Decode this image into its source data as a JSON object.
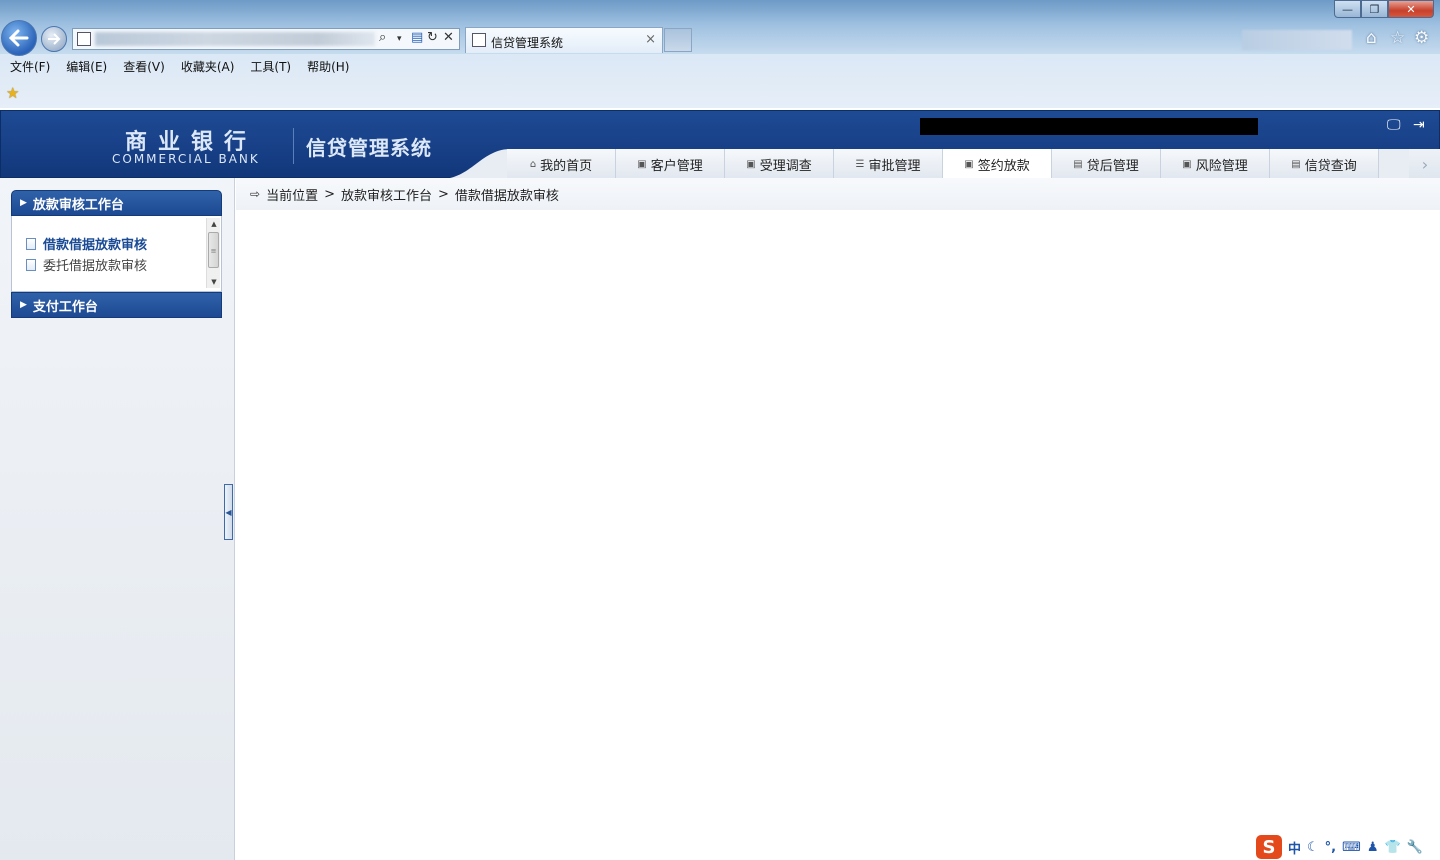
{
  "browser": {
    "tab_title": "信贷管理系统",
    "menu": [
      "文件(F)",
      "编辑(E)",
      "查看(V)",
      "收藏夹(A)",
      "工具(T)",
      "帮助(H)"
    ],
    "tab_close": "×",
    "win_min": "—",
    "win_max": "❐",
    "win_close": "✕"
  },
  "header": {
    "bank_cn": "商业银行",
    "bank_en": "COMMERCIAL BANK",
    "system_name": "信贷管理系统"
  },
  "nav_tabs": [
    {
      "label": "我的首页",
      "icon": "home-icon",
      "glyph": "⌂"
    },
    {
      "label": "客户管理",
      "icon": "customer-icon",
      "glyph": "▣"
    },
    {
      "label": "受理调查",
      "icon": "survey-icon",
      "glyph": "▣"
    },
    {
      "label": "审批管理",
      "icon": "list-icon",
      "glyph": "☰"
    },
    {
      "label": "签约放款",
      "icon": "contract-icon",
      "glyph": "▣",
      "active": true
    },
    {
      "label": "贷后管理",
      "icon": "postloan-icon",
      "glyph": "▤"
    },
    {
      "label": "风险管理",
      "icon": "risk-icon",
      "glyph": "▣"
    },
    {
      "label": "信贷查询",
      "icon": "query-icon",
      "glyph": "▤"
    }
  ],
  "sidebar": {
    "panel_audit": {
      "title": "放款审核工作台",
      "items": [
        "借款借据放款审核",
        "委托借据放款审核"
      ]
    },
    "panel_pay": {
      "title": "支付工作台"
    }
  },
  "breadcrumb": {
    "label": "当前位置",
    "items": [
      "放款审核工作台",
      "借款借据放款审核"
    ],
    "separator": ">"
  },
  "ime": {
    "logo": "S",
    "mode": "中",
    "items": [
      "☾",
      "°,",
      "⌨",
      "♟",
      "👕",
      "🔧"
    ]
  }
}
